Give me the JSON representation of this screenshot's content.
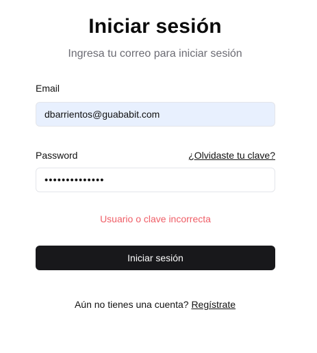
{
  "header": {
    "title": "Iniciar sesión",
    "subtitle": "Ingresa tu correo para iniciar sesión"
  },
  "form": {
    "email_label": "Email",
    "email_value": "dbarrientos@guababit.com",
    "password_label": "Password",
    "password_value": "••••••••••••••",
    "forgot_link": "¿Olvidaste tu clave?",
    "error_message": "Usuario o clave incorrecta",
    "submit_label": "Iniciar sesión"
  },
  "footer": {
    "prompt": "Aún no tienes una cuenta? ",
    "signup_link": "Regístrate"
  },
  "colors": {
    "error": "#ef5d66",
    "button_bg": "#18181b",
    "autofill_bg": "#e8f0fe",
    "muted_text": "#6b6b73"
  }
}
